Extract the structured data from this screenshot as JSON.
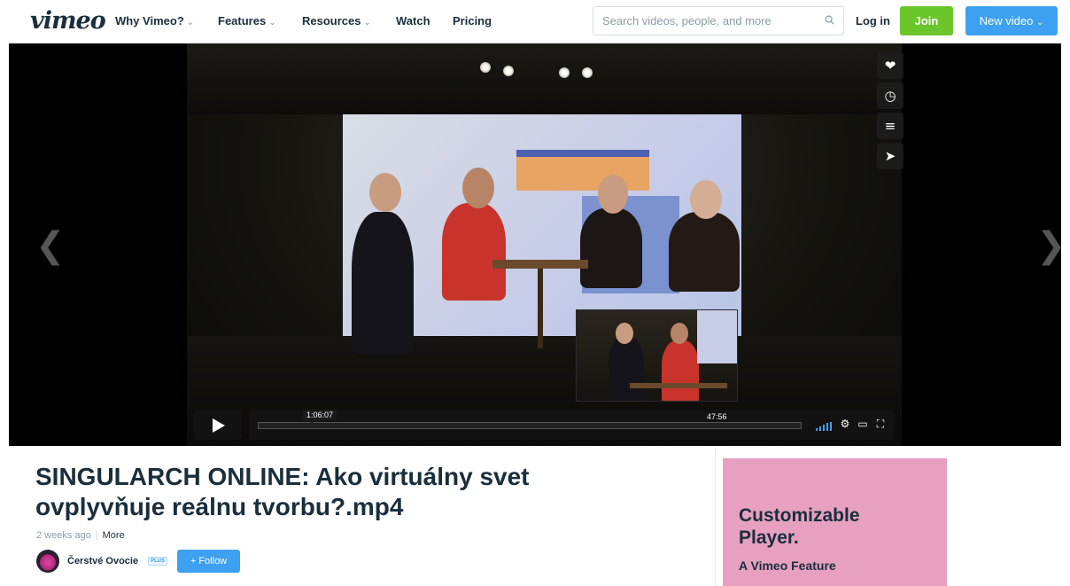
{
  "nav": {
    "logo": "vimeo",
    "items": [
      {
        "label": "Why Vimeo?",
        "dropdown": true
      },
      {
        "label": "Features",
        "dropdown": true
      },
      {
        "label": "Resources",
        "dropdown": true
      },
      {
        "label": "Watch",
        "dropdown": false
      },
      {
        "label": "Pricing",
        "dropdown": false
      }
    ],
    "search_placeholder": "Search videos, people, and more",
    "login": "Log in",
    "join": "Join",
    "new_video": "New video",
    "colors": {
      "join": "#6bc62b",
      "new_video": "#3ea0f0"
    }
  },
  "player": {
    "hover_time": "1:06:07",
    "duration": "47:56",
    "side_buttons": [
      "heart-icon",
      "clock-icon",
      "layers-icon",
      "send-icon"
    ],
    "control_icons": [
      "volume-icon",
      "gear-icon",
      "airplay-icon",
      "fullscreen-icon"
    ]
  },
  "video_info": {
    "title": "SINGULARCH ONLINE: Ako virtuálny svet ovplyvňuje reálnu tvorbu?.mp4",
    "posted": "2 weeks ago",
    "separator": "|",
    "more": "More",
    "channel": "Čerstvé Ovocie",
    "plus_badge": "PLUS",
    "follow": "+ Follow"
  },
  "ad": {
    "headline": "Customizable Player.",
    "subline": "A Vimeo Feature",
    "color": "#e7a0c0"
  }
}
